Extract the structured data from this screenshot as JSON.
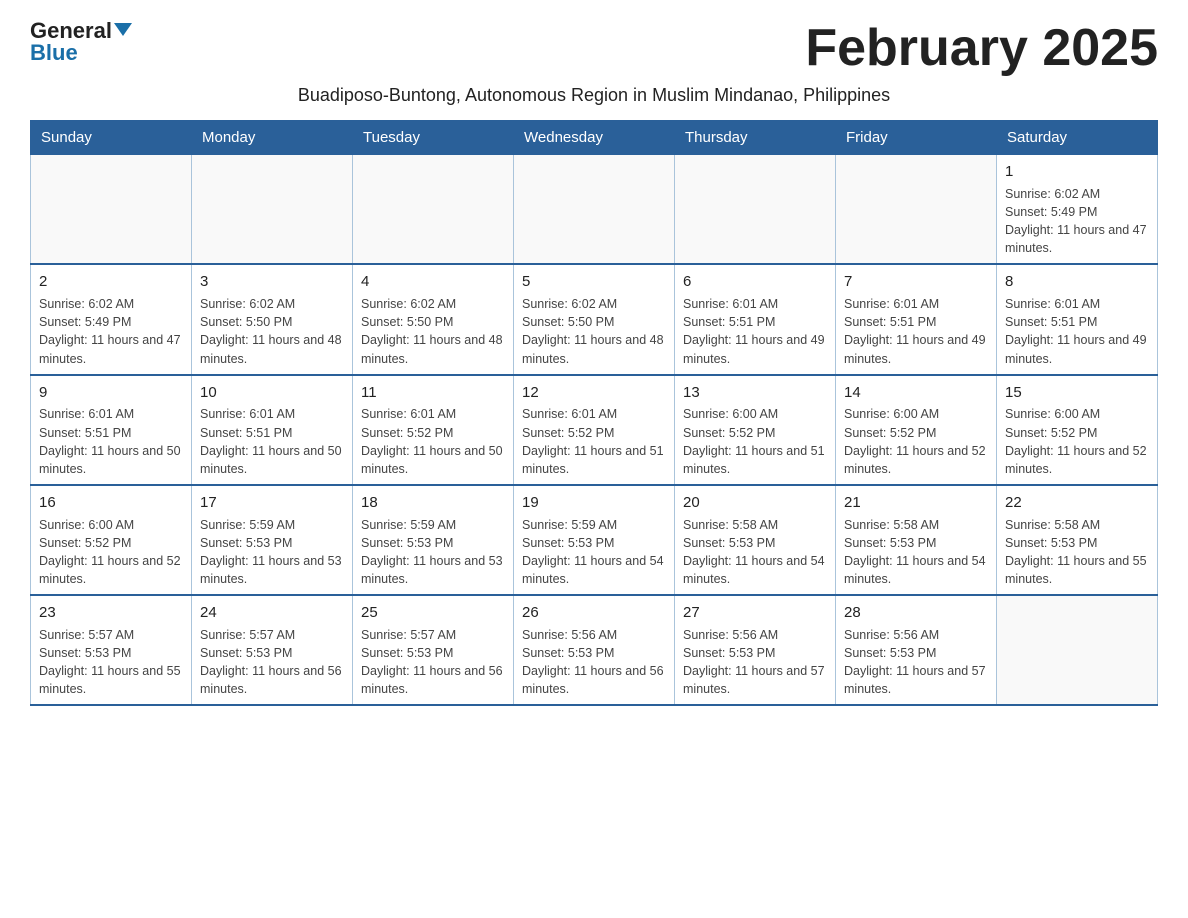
{
  "logo": {
    "general": "General",
    "blue": "Blue"
  },
  "title": "February 2025",
  "subtitle": "Buadiposo-Buntong, Autonomous Region in Muslim Mindanao, Philippines",
  "days_of_week": [
    "Sunday",
    "Monday",
    "Tuesday",
    "Wednesday",
    "Thursday",
    "Friday",
    "Saturday"
  ],
  "weeks": [
    [
      {
        "day": "",
        "info": ""
      },
      {
        "day": "",
        "info": ""
      },
      {
        "day": "",
        "info": ""
      },
      {
        "day": "",
        "info": ""
      },
      {
        "day": "",
        "info": ""
      },
      {
        "day": "",
        "info": ""
      },
      {
        "day": "1",
        "info": "Sunrise: 6:02 AM\nSunset: 5:49 PM\nDaylight: 11 hours and 47 minutes."
      }
    ],
    [
      {
        "day": "2",
        "info": "Sunrise: 6:02 AM\nSunset: 5:49 PM\nDaylight: 11 hours and 47 minutes."
      },
      {
        "day": "3",
        "info": "Sunrise: 6:02 AM\nSunset: 5:50 PM\nDaylight: 11 hours and 48 minutes."
      },
      {
        "day": "4",
        "info": "Sunrise: 6:02 AM\nSunset: 5:50 PM\nDaylight: 11 hours and 48 minutes."
      },
      {
        "day": "5",
        "info": "Sunrise: 6:02 AM\nSunset: 5:50 PM\nDaylight: 11 hours and 48 minutes."
      },
      {
        "day": "6",
        "info": "Sunrise: 6:01 AM\nSunset: 5:51 PM\nDaylight: 11 hours and 49 minutes."
      },
      {
        "day": "7",
        "info": "Sunrise: 6:01 AM\nSunset: 5:51 PM\nDaylight: 11 hours and 49 minutes."
      },
      {
        "day": "8",
        "info": "Sunrise: 6:01 AM\nSunset: 5:51 PM\nDaylight: 11 hours and 49 minutes."
      }
    ],
    [
      {
        "day": "9",
        "info": "Sunrise: 6:01 AM\nSunset: 5:51 PM\nDaylight: 11 hours and 50 minutes."
      },
      {
        "day": "10",
        "info": "Sunrise: 6:01 AM\nSunset: 5:51 PM\nDaylight: 11 hours and 50 minutes."
      },
      {
        "day": "11",
        "info": "Sunrise: 6:01 AM\nSunset: 5:52 PM\nDaylight: 11 hours and 50 minutes."
      },
      {
        "day": "12",
        "info": "Sunrise: 6:01 AM\nSunset: 5:52 PM\nDaylight: 11 hours and 51 minutes."
      },
      {
        "day": "13",
        "info": "Sunrise: 6:00 AM\nSunset: 5:52 PM\nDaylight: 11 hours and 51 minutes."
      },
      {
        "day": "14",
        "info": "Sunrise: 6:00 AM\nSunset: 5:52 PM\nDaylight: 11 hours and 52 minutes."
      },
      {
        "day": "15",
        "info": "Sunrise: 6:00 AM\nSunset: 5:52 PM\nDaylight: 11 hours and 52 minutes."
      }
    ],
    [
      {
        "day": "16",
        "info": "Sunrise: 6:00 AM\nSunset: 5:52 PM\nDaylight: 11 hours and 52 minutes."
      },
      {
        "day": "17",
        "info": "Sunrise: 5:59 AM\nSunset: 5:53 PM\nDaylight: 11 hours and 53 minutes."
      },
      {
        "day": "18",
        "info": "Sunrise: 5:59 AM\nSunset: 5:53 PM\nDaylight: 11 hours and 53 minutes."
      },
      {
        "day": "19",
        "info": "Sunrise: 5:59 AM\nSunset: 5:53 PM\nDaylight: 11 hours and 54 minutes."
      },
      {
        "day": "20",
        "info": "Sunrise: 5:58 AM\nSunset: 5:53 PM\nDaylight: 11 hours and 54 minutes."
      },
      {
        "day": "21",
        "info": "Sunrise: 5:58 AM\nSunset: 5:53 PM\nDaylight: 11 hours and 54 minutes."
      },
      {
        "day": "22",
        "info": "Sunrise: 5:58 AM\nSunset: 5:53 PM\nDaylight: 11 hours and 55 minutes."
      }
    ],
    [
      {
        "day": "23",
        "info": "Sunrise: 5:57 AM\nSunset: 5:53 PM\nDaylight: 11 hours and 55 minutes."
      },
      {
        "day": "24",
        "info": "Sunrise: 5:57 AM\nSunset: 5:53 PM\nDaylight: 11 hours and 56 minutes."
      },
      {
        "day": "25",
        "info": "Sunrise: 5:57 AM\nSunset: 5:53 PM\nDaylight: 11 hours and 56 minutes."
      },
      {
        "day": "26",
        "info": "Sunrise: 5:56 AM\nSunset: 5:53 PM\nDaylight: 11 hours and 56 minutes."
      },
      {
        "day": "27",
        "info": "Sunrise: 5:56 AM\nSunset: 5:53 PM\nDaylight: 11 hours and 57 minutes."
      },
      {
        "day": "28",
        "info": "Sunrise: 5:56 AM\nSunset: 5:53 PM\nDaylight: 11 hours and 57 minutes."
      },
      {
        "day": "",
        "info": ""
      }
    ]
  ]
}
